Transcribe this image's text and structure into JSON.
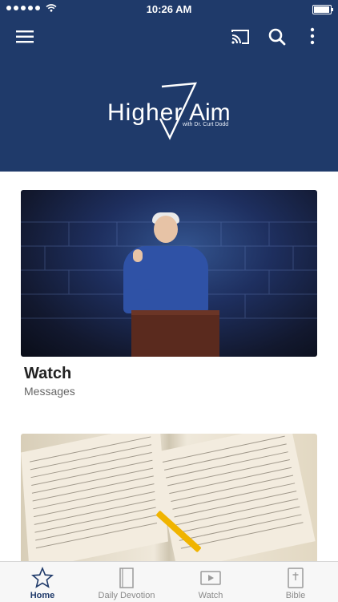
{
  "status_bar": {
    "time": "10:26 AM",
    "signal_dots": 5,
    "battery_level": 0.95
  },
  "header": {
    "icons": [
      "menu-icon",
      "cast-icon",
      "search-icon",
      "more-vertical-icon"
    ],
    "logo": {
      "word1": "Higher",
      "word2": "Aim",
      "subtitle": "with Dr. Curt Dodd"
    }
  },
  "cards": [
    {
      "title": "Watch",
      "subtitle": "Messages"
    },
    {
      "title": "",
      "subtitle": ""
    }
  ],
  "tabbar": {
    "tabs": [
      {
        "label": "Home",
        "icon": "star-icon",
        "active": true
      },
      {
        "label": "Daily Devotion",
        "icon": "book-icon",
        "active": false
      },
      {
        "label": "Watch",
        "icon": "play-video-icon",
        "active": false
      },
      {
        "label": "Bible",
        "icon": "bible-icon",
        "active": false
      }
    ]
  },
  "colors": {
    "brand_navy": "#1f3a6a",
    "tab_active": "#1f3a6a",
    "tab_inactive": "#8a8a8a"
  }
}
